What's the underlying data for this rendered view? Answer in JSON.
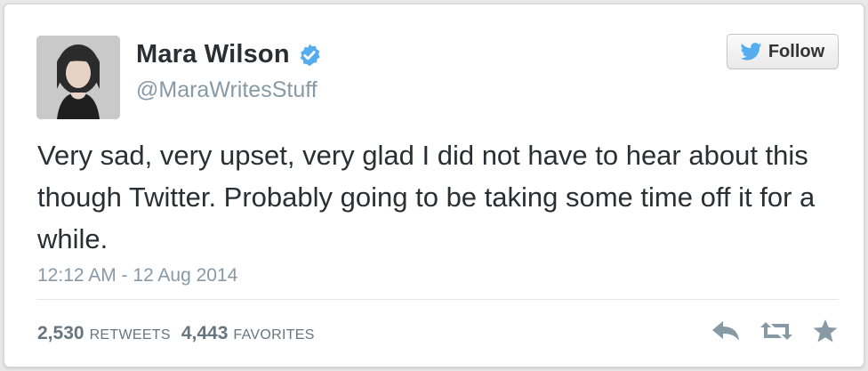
{
  "user": {
    "name": "Mara Wilson",
    "handle": "@MaraWritesStuff"
  },
  "follow_button": {
    "label": "Follow"
  },
  "tweet": {
    "text": "Very sad, very upset, very glad I did not have to hear about this though Twitter. Probably going to be taking some time off it for a while.",
    "timestamp": "12:12 AM - 12 Aug 2014"
  },
  "stats": {
    "retweets_count": "2,530",
    "retweets_label": "RETWEETS",
    "favorites_count": "4,443",
    "favorites_label": "FAVORITES"
  },
  "colors": {
    "verified": "#55acee",
    "twitter_blue": "#55acee",
    "text": "#292f33",
    "muted": "#8899a6",
    "action_icon": "#8899a6"
  },
  "icons": {
    "verified": "verified-badge-icon",
    "follow_bird": "twitter-bird-icon",
    "reply": "reply-icon",
    "retweet": "retweet-icon",
    "favorite": "star-icon"
  }
}
